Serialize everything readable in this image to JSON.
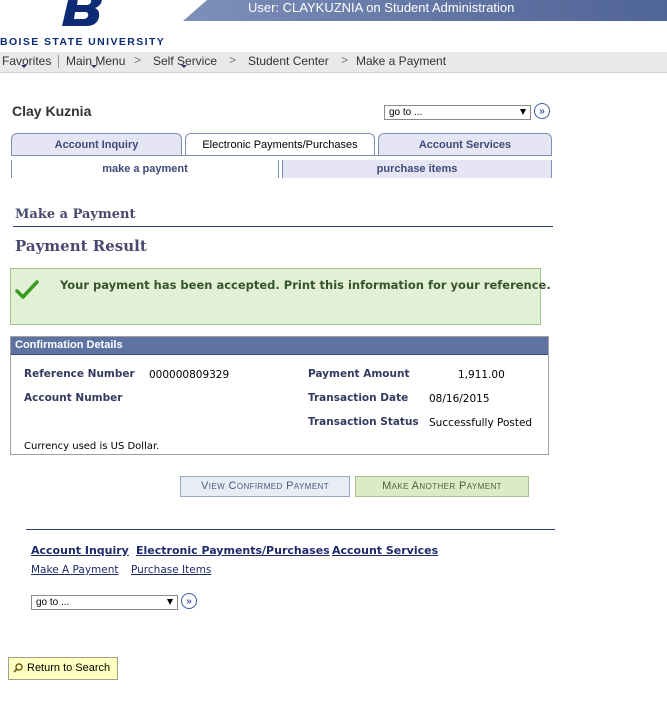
{
  "banner": {
    "user_text": "User: CLAYKUZNIA on Student Administration",
    "university": "BOISE STATE UNIVERSITY"
  },
  "breadcrumb": {
    "items": [
      "Favorites",
      "Main Menu",
      "Self Service",
      "Student Center",
      "Make a Payment"
    ],
    "separator": ">"
  },
  "student_name": "Clay Kuznia",
  "goto_top": {
    "value": "go to ...",
    "button": "»"
  },
  "tabs": [
    {
      "label": "Account Inquiry",
      "active": false
    },
    {
      "label": "Electronic Payments/Purchases",
      "active": true
    },
    {
      "label": "Account Services",
      "active": false
    }
  ],
  "subtabs": [
    {
      "label": "make a payment",
      "active": true
    },
    {
      "label": "purchase items",
      "active": false
    }
  ],
  "page_title": "Make a Payment",
  "section_title": "Payment Result",
  "message": {
    "text": "Your payment has been accepted. Print this information for your reference.",
    "icon": "checkmark-icon"
  },
  "confirmation": {
    "header": "Confirmation Details",
    "reference_number_label": "Reference Number",
    "reference_number": "000000809329",
    "account_number_label": "Account Number",
    "account_number": "",
    "payment_amount_label": "Payment Amount",
    "payment_amount": "1,911.00",
    "transaction_date_label": "Transaction Date",
    "transaction_date": "08/16/2015",
    "transaction_status_label": "Transaction Status",
    "transaction_status": "Successfully Posted",
    "currency_note": "Currency used is US Dollar."
  },
  "buttons": {
    "view_confirmed": "View Confirmed Payment",
    "make_another": "Make Another Payment"
  },
  "footer_links": {
    "row1": [
      "Account Inquiry",
      "Electronic Payments/Purchases",
      "Account Services"
    ],
    "row2": [
      "Make A Payment",
      "Purchase Items"
    ]
  },
  "goto_bottom": {
    "value": "go to ...",
    "button": "»"
  },
  "return_to_search": "Return to Search",
  "colors": {
    "brand_blue": "#0c2b74",
    "banner": "#5f73a3",
    "success_bg": "#e2f0d5"
  }
}
